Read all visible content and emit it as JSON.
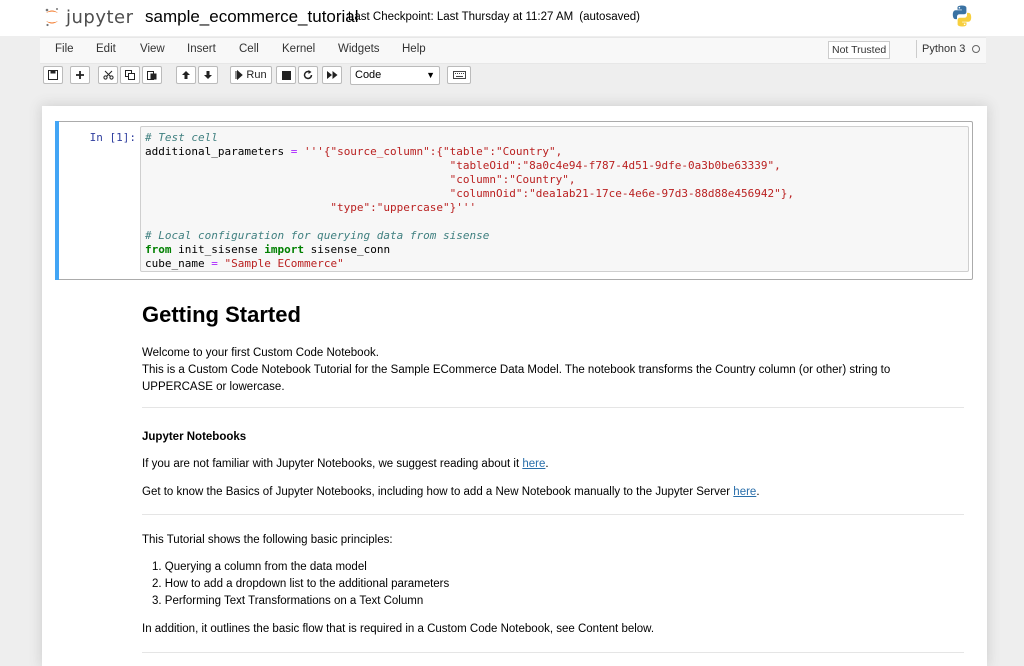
{
  "header": {
    "logo_text": "jupyter",
    "notebook_name": "sample_ecommerce_tutorial",
    "checkpoint": "Last Checkpoint: Last Thursday at 11:27 AM",
    "autosaved": "(autosaved)"
  },
  "menubar": {
    "items": [
      "File",
      "Edit",
      "View",
      "Insert",
      "Cell",
      "Kernel",
      "Widgets",
      "Help"
    ],
    "trusted": "Not Trusted",
    "kernel": "Python 3"
  },
  "toolbar": {
    "run_label": "Run",
    "cell_type": "Code",
    "icons": [
      "save-icon",
      "plus-icon",
      "cut-icon",
      "copy-icon",
      "paste-icon",
      "arrow-up-icon",
      "arrow-down-icon",
      "run-icon",
      "stop-icon",
      "restart-icon",
      "fast-forward-icon",
      "keyboard-icon"
    ]
  },
  "code_cell": {
    "prompt": "In [1]:",
    "lines": [
      "# Test cell",
      "additional_parameters = '''{\"source_column\":{\"table\":\"Country\",",
      "                                              \"tableOid\":\"8a0c4e94-f787-4d51-9dfe-0a3b0be63339\",",
      "                                              \"column\":\"Country\",",
      "                                              \"columnOid\":\"dea1ab21-17ce-4e6e-97d3-88d88e456942\"},",
      "                            \"type\":\"uppercase\"}'''",
      "",
      "# Local configuration for querying data from sisense",
      "from init_sisense import sisense_conn",
      "cube_name = \"Sample ECommerce\""
    ]
  },
  "markdown": {
    "title": "Getting Started",
    "welcome": "Welcome to your first Custom Code Notebook.",
    "intro": "This is a Custom Code Notebook Tutorial for the Sample ECommerce Data Model. The notebook transforms the Country column (or other) string to UPPERCASE or lowercase.",
    "subtitle": "Jupyter Notebooks",
    "p1_text": "If you are not familiar with Jupyter Notebooks, we suggest reading about it ",
    "p1_link": "here",
    "p1_end": ".",
    "p2_text": "Get to know the Basics of Jupyter Notebooks, including how to add a New Notebook manually to the Jupyter Server ",
    "p2_link": "here",
    "p2_end": ".",
    "principles_intro": "This Tutorial shows the following basic principles:",
    "principles": [
      "1. Querying a column from the data model",
      "2. How to add a dropdown list to the additional parameters",
      "3. Performing Text Transformations on a Text Column"
    ],
    "outline": "In addition, it outlines the basic flow that is required in a Custom Code Notebook, see Content below."
  },
  "colors": {
    "accent_selected": "#42a5f5",
    "link": "#296eaa",
    "prompt": "#303f9f",
    "jupyter_orange": "#f37726"
  }
}
